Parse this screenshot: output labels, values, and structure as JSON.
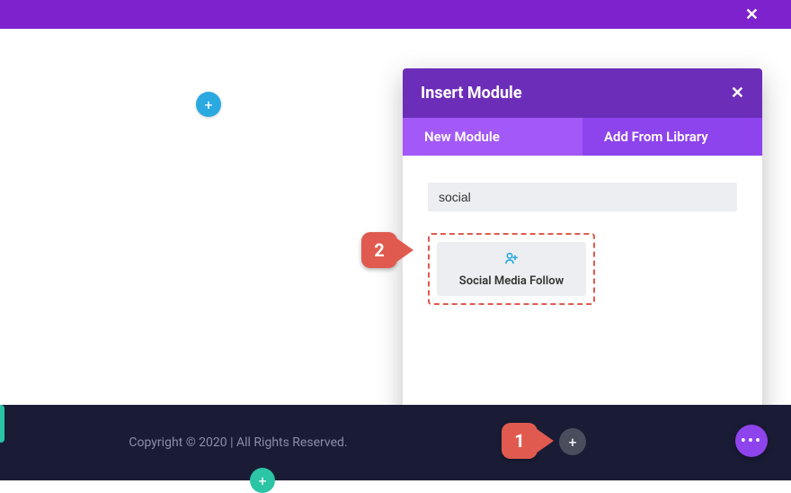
{
  "topbar": {
    "close_glyph": "✕"
  },
  "canvas": {
    "add_glyph": "+"
  },
  "modal": {
    "title": "Insert Module",
    "close_glyph": "✕",
    "tabs": [
      {
        "label": "New Module",
        "active": true
      },
      {
        "label": "Add From Library",
        "active": false
      }
    ],
    "search_value": "social",
    "modules": [
      {
        "label": "Social Media Follow",
        "icon": "person-follow-icon"
      }
    ]
  },
  "footer": {
    "copyright": "Copyright © 2020 | All Rights Reserved.",
    "add_dark_glyph": "+",
    "add_green_glyph": "+",
    "fab_glyph": "•••"
  },
  "callouts": {
    "one": "1",
    "two": "2"
  },
  "colors": {
    "purple_dark": "#6c2eb9",
    "purple_mid": "#8e44ec",
    "purple_light": "#a259f7",
    "blue": "#29a9e0",
    "green": "#2bc4a5",
    "red": "#e05a4f",
    "footer_bg": "#1a1c36"
  }
}
